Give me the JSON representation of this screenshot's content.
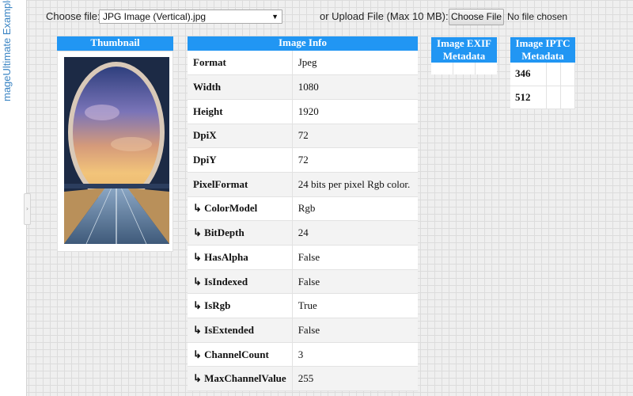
{
  "sidebar": {
    "label": "mageUltimate Examples",
    "handle_glyph": "›"
  },
  "toolbar": {
    "choose_file_label": "Choose file:",
    "selected_file": "JPG Image (Vertical).jpg",
    "upload_label": "or Upload File (Max 10 MB):",
    "upload_button": "Choose File",
    "no_file_text": "No file chosen"
  },
  "thumbnail": {
    "header": "Thumbnail"
  },
  "image_info": {
    "header": "Image Info",
    "rows": [
      {
        "key": "Format",
        "value": "Jpeg"
      },
      {
        "key": "Width",
        "value": "1080"
      },
      {
        "key": "Height",
        "value": "1920"
      },
      {
        "key": "DpiX",
        "value": "72"
      },
      {
        "key": "DpiY",
        "value": "72"
      },
      {
        "key": "PixelFormat",
        "value": "24 bits per pixel Rgb color."
      },
      {
        "key": "↳ ColorModel",
        "value": "Rgb"
      },
      {
        "key": "↳ BitDepth",
        "value": "24"
      },
      {
        "key": "↳ HasAlpha",
        "value": "False"
      },
      {
        "key": "↳ IsIndexed",
        "value": "False"
      },
      {
        "key": "↳ IsRgb",
        "value": "True"
      },
      {
        "key": "↳ IsExtended",
        "value": "False"
      },
      {
        "key": "↳ ChannelCount",
        "value": "3"
      },
      {
        "key": "↳ MaxChannelValue",
        "value": "255"
      }
    ]
  },
  "exif": {
    "header_line1": "Image EXIF",
    "header_line2": "Metadata"
  },
  "iptc": {
    "header_line1": "Image IPTC",
    "header_line2": "Metadata",
    "rows": [
      {
        "value": "346"
      },
      {
        "value": "512"
      }
    ]
  }
}
